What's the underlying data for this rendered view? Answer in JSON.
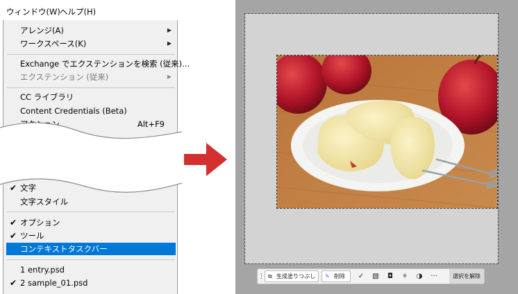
{
  "menubar": {
    "window_label": "ウィンドウ(W)",
    "help_label": "ヘルプ(H)"
  },
  "menu_top": [
    {
      "label": "アレンジ(A)",
      "submenu": true
    },
    {
      "label": "ワークスペース(K)",
      "submenu": true
    },
    {
      "label": "Exchange でエクステンションを検索 (従来)..."
    },
    {
      "label": "エクステンション (従来)",
      "submenu": true,
      "disabled": true
    },
    {
      "label": "CC ライブラリ"
    },
    {
      "label": "Content Credentials (Beta)"
    },
    {
      "label": "アクション",
      "shortcut": "Alt+F9"
    }
  ],
  "menu_bottom": [
    {
      "label": "文字",
      "checked": true
    },
    {
      "label": "文字スタイル"
    },
    {
      "label": "オプション",
      "checked": true
    },
    {
      "label": "ツール",
      "checked": true
    },
    {
      "label": "コンテキストタスクバー",
      "selected": true
    },
    {
      "label": "1 entry.psd"
    },
    {
      "label": "2 sample_01.psd",
      "checked": true
    }
  ],
  "glyphs": {
    "check": "✔",
    "submenu_arrow": "▶"
  },
  "taskbar": {
    "generative_fill_label": "生成塗りつぶし",
    "delete_label": "削除",
    "more_label": "···",
    "deselect_label": "選択を解除"
  },
  "icons": {
    "generative_fill": "generative-fill-icon",
    "delete": "brush-remove-icon",
    "modify": "modify-selection-icon",
    "invert": "invert-selection-icon",
    "mask": "mask-icon",
    "fill": "fill-bucket-icon",
    "adjust": "adjustment-icon",
    "grip": "grip-icon"
  },
  "colors": {
    "selected_bg": "#0078d7",
    "arrow": "#d32f2f",
    "workspace": "#a5a5a5",
    "canvas": "#d3d3d3"
  }
}
